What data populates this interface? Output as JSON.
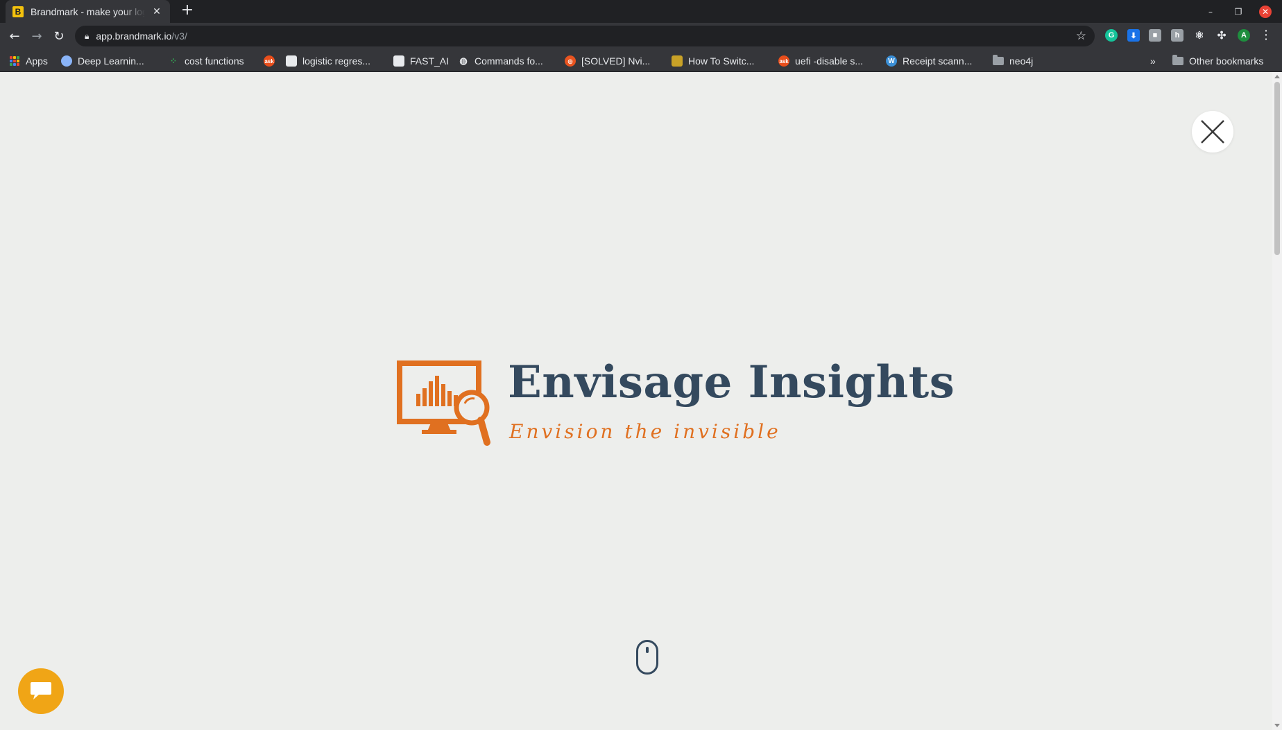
{
  "browser": {
    "tab_title": "Brandmark - make your logo",
    "tab_favicon_letter": "B",
    "new_tab": "+",
    "url_host": "app.brandmark.io",
    "url_path": "/v3/",
    "profile_initial": "A",
    "bookmarks": [
      {
        "label": "Apps",
        "icon": "apps-grid-icon"
      },
      {
        "label": "Deep Learnin...",
        "icon": "brain-icon"
      },
      {
        "label": "cost functions",
        "icon": "dots-icon"
      },
      {
        "label": "",
        "icon": "ask-icon"
      },
      {
        "label": "logistic regres...",
        "icon": "page-icon"
      },
      {
        "label": "FAST_AI",
        "icon": "page-icon"
      },
      {
        "label": "Commands fo...",
        "icon": "globe-icon"
      },
      {
        "label": "[SOLVED] Nvi...",
        "icon": "ubuntu-icon"
      },
      {
        "label": "How To Switc...",
        "icon": "avatar-icon"
      },
      {
        "label": "uefi -disable s...",
        "icon": "ask-icon"
      },
      {
        "label": "Receipt scann...",
        "icon": "wordpress-icon"
      },
      {
        "label": "neo4j",
        "icon": "folder-icon"
      }
    ],
    "more_bookmarks": "»",
    "other_bookmarks": "Other bookmarks"
  },
  "logo": {
    "name": "Envisage Insights",
    "tagline": "Envision the invisible",
    "colors": {
      "primary": "#34495e",
      "accent": "#e07020"
    }
  },
  "colors": {
    "page_bg": "#edeeec",
    "chat": "#f0a516"
  }
}
